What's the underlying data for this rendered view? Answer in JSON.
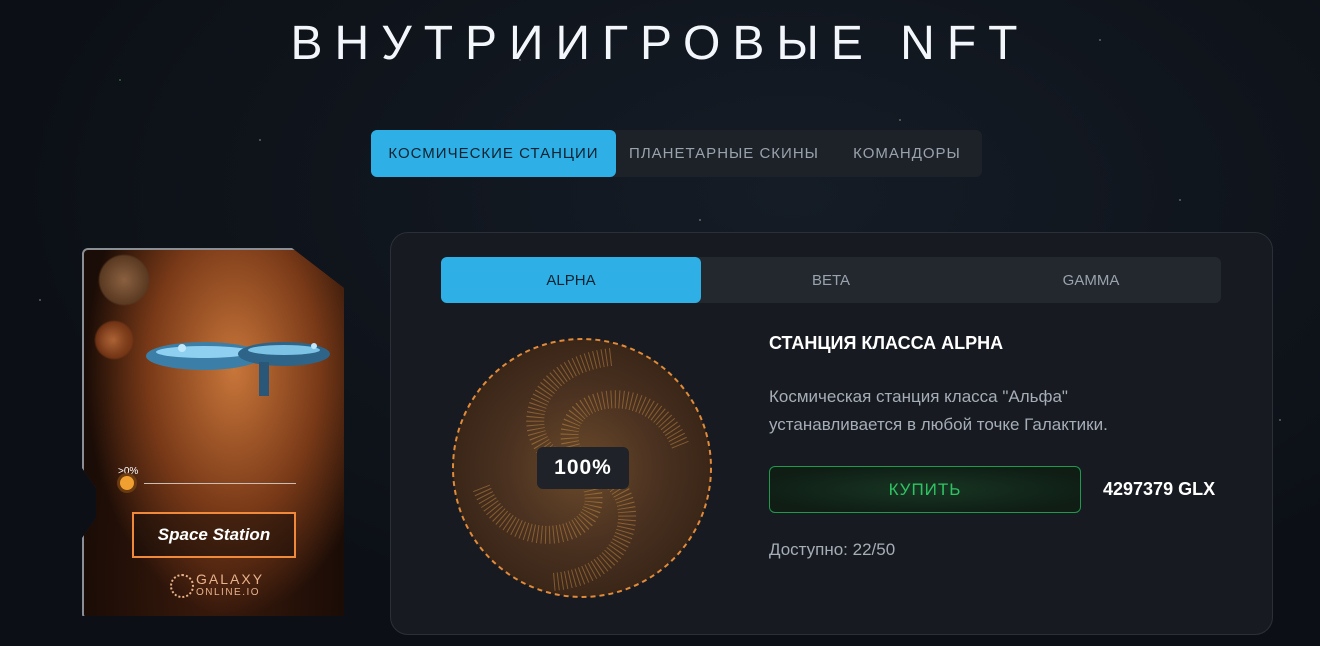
{
  "page": {
    "title": "ВНУТРИИГРОВЫЕ NFT"
  },
  "category_tabs": [
    {
      "label": "КОСМИЧЕСКИЕ СТАНЦИИ",
      "active": true
    },
    {
      "label": "ПЛАНЕТАРНЫЕ СКИНЫ",
      "active": false
    },
    {
      "label": "КОМАНДОРЫ",
      "active": false
    }
  ],
  "card": {
    "level_text": ">0%",
    "name": "Space Station",
    "logo_line1": "GALAXY",
    "logo_line2": "ONLINE.IO",
    "accent_color": "#f08a3a"
  },
  "class_tabs": [
    {
      "label": "ALPHA",
      "active": true
    },
    {
      "label": "BETA",
      "active": false
    },
    {
      "label": "GAMMA",
      "active": false
    }
  ],
  "station": {
    "gauge_percent_label": "100%",
    "gauge_percent": 100,
    "title": "СТАНЦИЯ КЛАССА ALPHA",
    "description": "Космическая станция класса \"Альфа\" устанавливается в любой точке Галактики.",
    "buy_label": "КУПИТЬ",
    "price": "4297379 GLX",
    "available": "Доступно: 22/50"
  },
  "colors": {
    "accent": "#2eb0e6",
    "buy": "#2fc463",
    "gauge": "#d49a4a"
  }
}
